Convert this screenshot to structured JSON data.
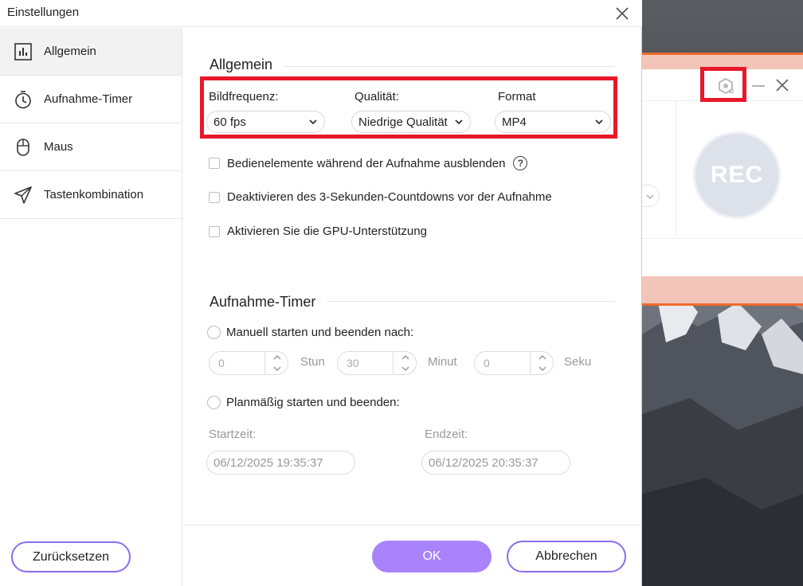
{
  "window": {
    "title": "Einstellungen"
  },
  "sidebar": {
    "items": [
      {
        "label": "Allgemein",
        "icon": "bar-chart-icon",
        "active": true
      },
      {
        "label": "Aufnahme-Timer",
        "icon": "stopwatch-icon",
        "active": false
      },
      {
        "label": "Maus",
        "icon": "mouse-icon",
        "active": false
      },
      {
        "label": "Tastenkombination",
        "icon": "paper-plane-icon",
        "active": false
      }
    ],
    "reset_label": "Zurücksetzen"
  },
  "general": {
    "title": "Allgemein",
    "framerate": {
      "label": "Bildfrequenz:",
      "value": "60 fps"
    },
    "quality": {
      "label": "Qualität:",
      "value": "Niedrige Qualität"
    },
    "format": {
      "label": "Format",
      "value": "MP4"
    },
    "options": [
      {
        "label": "Bedienelemente während der Aufnahme ausblenden",
        "checked": false,
        "help": true
      },
      {
        "label": "Deaktivieren des 3-Sekunden-Countdowns vor der Aufnahme",
        "checked": false,
        "help": false
      },
      {
        "label": "Aktivieren Sie die GPU-Unterstützung",
        "checked": false,
        "help": false
      }
    ],
    "help_glyph": "?"
  },
  "timer": {
    "title": "Aufnahme-Timer",
    "manual_label": "Manuell starten und beenden nach:",
    "hours": {
      "value": "0",
      "unit": "Stun"
    },
    "minutes": {
      "value": "30",
      "unit": "Minut"
    },
    "seconds": {
      "value": "0",
      "unit": "Seku"
    },
    "scheduled_label": "Planmäßig starten und beenden:",
    "start": {
      "label": "Startzeit:",
      "value": "06/12/2025 19:35:37"
    },
    "end": {
      "label": "Endzeit:",
      "value": "06/12/2025 20:35:37"
    }
  },
  "footer": {
    "ok_label": "OK",
    "cancel_label": "Abbrechen"
  },
  "recorder": {
    "rec_label": "REC"
  },
  "colors": {
    "accent": "#a983fb",
    "accent_border": "#8b6cf0",
    "highlight": "#e8182b",
    "recorder_stripe": "#f26a2a"
  }
}
